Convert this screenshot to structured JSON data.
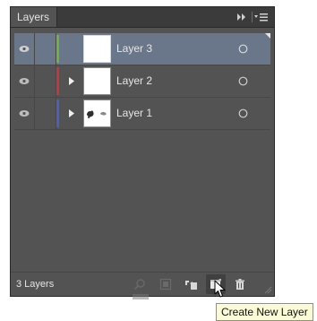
{
  "panel": {
    "tab_label": "Layers",
    "collapse_icon": "double-chevron-right-icon",
    "menu_icon": "panel-menu-icon"
  },
  "layers": [
    {
      "name": "Layer 3",
      "visible": true,
      "selected": true,
      "expand_arrow": false,
      "color": "#6db33f",
      "thumbnail": "blank"
    },
    {
      "name": "Layer 2",
      "visible": true,
      "selected": false,
      "expand_arrow": true,
      "color": "#c8363c",
      "thumbnail": "blank"
    },
    {
      "name": "Layer 1",
      "visible": true,
      "selected": false,
      "expand_arrow": true,
      "color": "#4a5fbf",
      "thumbnail": "artwork"
    }
  ],
  "footer": {
    "count_label": "3 Layers",
    "buttons": [
      {
        "name": "locate-object-icon",
        "enabled": false
      },
      {
        "name": "make-clipping-mask-icon",
        "enabled": false
      },
      {
        "name": "create-new-sublayer-icon",
        "enabled": true
      },
      {
        "name": "create-new-layer-icon",
        "enabled": true,
        "hovered": true
      },
      {
        "name": "delete-icon",
        "enabled": true
      }
    ]
  },
  "tooltip": {
    "text": "Create New Layer"
  },
  "colors": {
    "panel_bg": "#535353",
    "selected_row": "#6a7689",
    "tooltip_bg": "#fafad6"
  }
}
